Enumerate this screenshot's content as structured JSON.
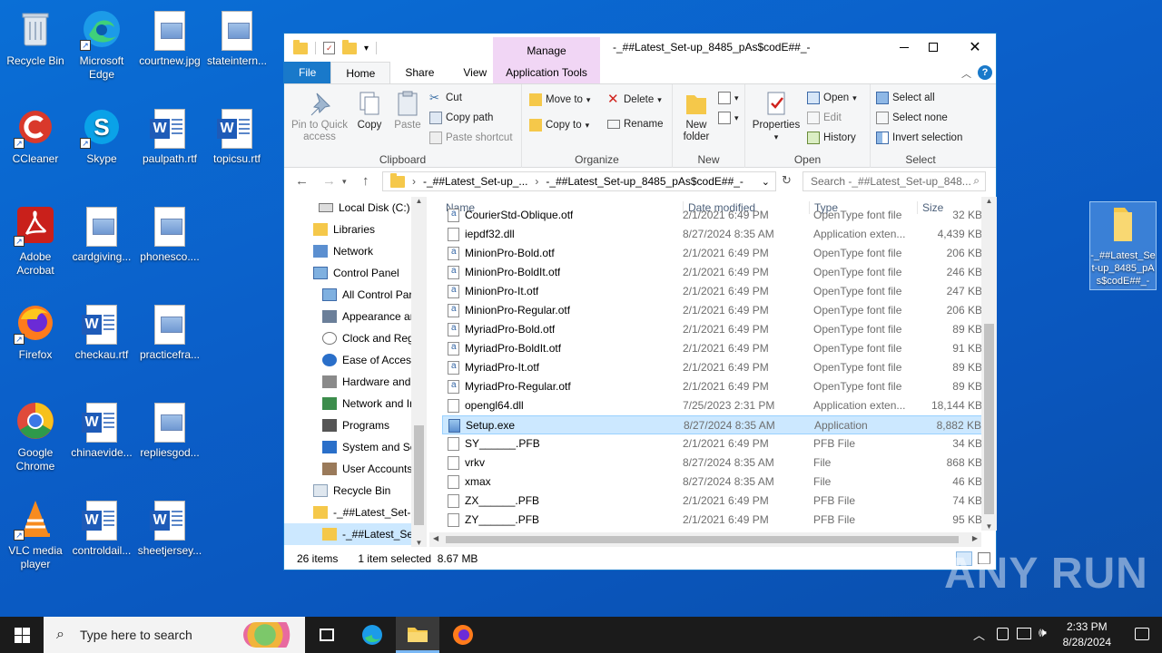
{
  "desktop": {
    "icons": [
      {
        "label": "Recycle Bin"
      },
      {
        "label": "Microsoft Edge"
      },
      {
        "label": "courtnew.jpg"
      },
      {
        "label": "stateintern..."
      },
      {
        "label": "CCleaner"
      },
      {
        "label": "Skype"
      },
      {
        "label": "paulpath.rtf"
      },
      {
        "label": "topicsu.rtf"
      },
      {
        "label": "Adobe Acrobat"
      },
      {
        "label": "cardgiving..."
      },
      {
        "label": "phonesco...."
      },
      {
        "label": "Firefox"
      },
      {
        "label": "checkau.rtf"
      },
      {
        "label": "practicefra..."
      },
      {
        "label": "Google Chrome"
      },
      {
        "label": "chinaevide..."
      },
      {
        "label": "repliesgod..."
      },
      {
        "label": "VLC media player"
      },
      {
        "label": "controldail..."
      },
      {
        "label": "sheetjersey..."
      },
      {
        "label": "-_##Latest_Set-up_8485_pAs$codE##_-"
      }
    ]
  },
  "window": {
    "title": "-_##Latest_Set-up_8485_pAs$codE##_-",
    "manage_label": "Manage",
    "tabs": {
      "file": "File",
      "home": "Home",
      "share": "Share",
      "view": "View",
      "app_tools": "Application Tools"
    },
    "ribbon": {
      "clipboard": {
        "label": "Clipboard",
        "pin": "Pin to Quick access",
        "copy": "Copy",
        "paste": "Paste",
        "cut": "Cut",
        "copy_path": "Copy path",
        "paste_shortcut": "Paste shortcut"
      },
      "organize": {
        "label": "Organize",
        "move_to": "Move to",
        "copy_to": "Copy to",
        "delete": "Delete",
        "rename": "Rename"
      },
      "new": {
        "label": "New",
        "new_folder": "New folder"
      },
      "open": {
        "label": "Open",
        "properties": "Properties",
        "open": "Open",
        "edit": "Edit",
        "history": "History"
      },
      "select": {
        "label": "Select",
        "select_all": "Select all",
        "select_none": "Select none",
        "invert": "Invert selection"
      }
    },
    "address": {
      "crumb1": "-_##Latest_Set-up_...",
      "crumb2": "-_##Latest_Set-up_8485_pAs$codE##_-",
      "search_placeholder": "Search -_##Latest_Set-up_848..."
    },
    "nav": [
      {
        "label": "Local Disk (C:)"
      },
      {
        "label": "Libraries"
      },
      {
        "label": "Network"
      },
      {
        "label": "Control Panel"
      },
      {
        "label": "All Control Par"
      },
      {
        "label": "Appearance an"
      },
      {
        "label": "Clock and Regi"
      },
      {
        "label": "Ease of Access"
      },
      {
        "label": "Hardware and"
      },
      {
        "label": "Network and Ir"
      },
      {
        "label": "Programs"
      },
      {
        "label": "System and Se"
      },
      {
        "label": "User Accounts"
      },
      {
        "label": "Recycle Bin"
      },
      {
        "label": "-_##Latest_Set-u"
      },
      {
        "label": "-_##Latest_Set"
      }
    ],
    "columns": {
      "name": "Name",
      "date": "Date modified",
      "type": "Type",
      "size": "Size"
    },
    "files": [
      {
        "name": "CourierStd-Oblique.otf",
        "date": "2/1/2021 6:49 PM",
        "type": "OpenType font file",
        "size": "32 KB"
      },
      {
        "name": "iepdf32.dll",
        "date": "8/27/2024 8:35 AM",
        "type": "Application exten...",
        "size": "4,439 KB"
      },
      {
        "name": "MinionPro-Bold.otf",
        "date": "2/1/2021 6:49 PM",
        "type": "OpenType font file",
        "size": "206 KB"
      },
      {
        "name": "MinionPro-BoldIt.otf",
        "date": "2/1/2021 6:49 PM",
        "type": "OpenType font file",
        "size": "246 KB"
      },
      {
        "name": "MinionPro-It.otf",
        "date": "2/1/2021 6:49 PM",
        "type": "OpenType font file",
        "size": "247 KB"
      },
      {
        "name": "MinionPro-Regular.otf",
        "date": "2/1/2021 6:49 PM",
        "type": "OpenType font file",
        "size": "206 KB"
      },
      {
        "name": "MyriadPro-Bold.otf",
        "date": "2/1/2021 6:49 PM",
        "type": "OpenType font file",
        "size": "89 KB"
      },
      {
        "name": "MyriadPro-BoldIt.otf",
        "date": "2/1/2021 6:49 PM",
        "type": "OpenType font file",
        "size": "91 KB"
      },
      {
        "name": "MyriadPro-It.otf",
        "date": "2/1/2021 6:49 PM",
        "type": "OpenType font file",
        "size": "89 KB"
      },
      {
        "name": "MyriadPro-Regular.otf",
        "date": "2/1/2021 6:49 PM",
        "type": "OpenType font file",
        "size": "89 KB"
      },
      {
        "name": "opengl64.dll",
        "date": "7/25/2023 2:31 PM",
        "type": "Application exten...",
        "size": "18,144 KB"
      },
      {
        "name": "Setup.exe",
        "date": "8/27/2024 8:35 AM",
        "type": "Application",
        "size": "8,882 KB"
      },
      {
        "name": "SY______.PFB",
        "date": "2/1/2021 6:49 PM",
        "type": "PFB File",
        "size": "34 KB"
      },
      {
        "name": "vrkv",
        "date": "8/27/2024 8:35 AM",
        "type": "File",
        "size": "868 KB"
      },
      {
        "name": "xmax",
        "date": "8/27/2024 8:35 AM",
        "type": "File",
        "size": "46 KB"
      },
      {
        "name": "ZX______.PFB",
        "date": "2/1/2021 6:49 PM",
        "type": "PFB File",
        "size": "74 KB"
      },
      {
        "name": "ZY______.PFB",
        "date": "2/1/2021 6:49 PM",
        "type": "PFB File",
        "size": "95 KB"
      }
    ],
    "status": {
      "count": "26 items",
      "selected": "1 item selected",
      "size": "8.67 MB"
    }
  },
  "taskbar": {
    "search_placeholder": "Type here to search",
    "time": "2:33 PM",
    "date": "8/28/2024"
  },
  "watermark": "ANY RUN",
  "colors": {
    "accent": "#1979ca",
    "selection": "#cce8ff",
    "manage_tab": "#f1d6f5"
  }
}
